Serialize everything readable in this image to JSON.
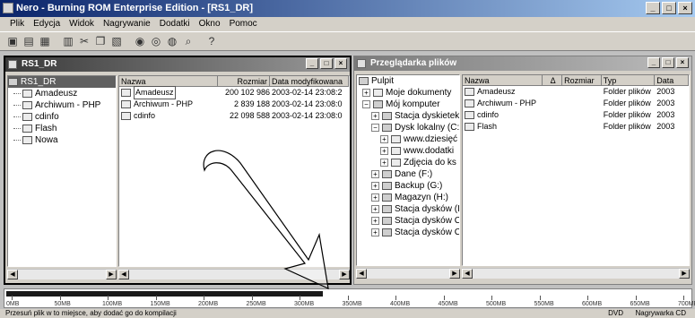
{
  "window": {
    "title": "Nero - Burning ROM Enterprise Edition - [RS1_DR]"
  },
  "menubar": [
    "Plik",
    "Edycja",
    "Widok",
    "Nagrywanie",
    "Dodatki",
    "Okno",
    "Pomoc"
  ],
  "toolbar": {
    "icons": [
      "new-icon",
      "open-icon",
      "save-icon",
      "print-icon",
      "cut-icon",
      "copy-icon",
      "paste-icon",
      "burn-icon",
      "info-icon",
      "disc-icon",
      "search-icon",
      "help-icon"
    ]
  },
  "left_pane": {
    "title": "RS1_DR",
    "tree": [
      {
        "label": "RS1_DR",
        "selected": true
      },
      {
        "label": "Amadeusz"
      },
      {
        "label": "Archiwum - PHP"
      },
      {
        "label": "cdinfo"
      },
      {
        "label": "Flash"
      },
      {
        "label": "Nowa"
      }
    ],
    "columns": [
      "Nazwa",
      "Rozmiar",
      "Data modyfikowana"
    ],
    "files": [
      {
        "name": "Amadeusz",
        "size": "200 102 986",
        "date": "2003-02-14 23:08:2"
      },
      {
        "name": "Archiwum - PHP",
        "size": "2 839 188",
        "date": "2003-02-14 23:08:0"
      },
      {
        "name": "cdinfo",
        "size": "22 098 588",
        "date": "2003-02-14 23:08:0"
      }
    ]
  },
  "right_pane": {
    "title": "Przeglądarka plików",
    "tree": [
      {
        "label": "Pulpit",
        "indent": 0
      },
      {
        "label": "Moje dokumenty",
        "indent": 1
      },
      {
        "label": "Mój komputer",
        "indent": 1
      },
      {
        "label": "Stacja dyskietek",
        "indent": 2
      },
      {
        "label": "Dysk lokalny (C:)",
        "indent": 2
      },
      {
        "label": "www.dziesięć",
        "indent": 3
      },
      {
        "label": "www.dodatki",
        "indent": 3
      },
      {
        "label": "Zdjęcia do ks",
        "indent": 3
      },
      {
        "label": "Dane (F:)",
        "indent": 2
      },
      {
        "label": "Backup (G:)",
        "indent": 2
      },
      {
        "label": "Magazyn (H:)",
        "indent": 2
      },
      {
        "label": "Stacja dysków (I:)",
        "indent": 2
      },
      {
        "label": "Stacja dysków CD",
        "indent": 2
      },
      {
        "label": "Stacja dysków CD",
        "indent": 2
      }
    ],
    "columns": [
      "Nazwa",
      "Δ",
      "Rozmiar",
      "Typ",
      "Data"
    ],
    "files": [
      {
        "name": "Amadeusz",
        "type": "Folder plików",
        "date": "2003"
      },
      {
        "name": "Archiwum - PHP",
        "type": "Folder plików",
        "date": "2003"
      },
      {
        "name": "cdinfo",
        "type": "Folder plików",
        "date": "2003"
      },
      {
        "name": "Flash",
        "type": "Folder plików",
        "date": "2003"
      }
    ]
  },
  "ruler": {
    "ticks": [
      "0MB",
      "50MB",
      "100MB",
      "150MB",
      "200MB",
      "250MB",
      "300MB",
      "350MB",
      "400MB",
      "450MB",
      "500MB",
      "550MB",
      "600MB",
      "650MB",
      "700MB"
    ],
    "filled_fraction": 0.46
  },
  "statusbar": {
    "left": "Przesuń plik w to miejsce, aby dodać go do kompilacji",
    "right1": "DVD",
    "right2": "Nagrywarka CD"
  }
}
